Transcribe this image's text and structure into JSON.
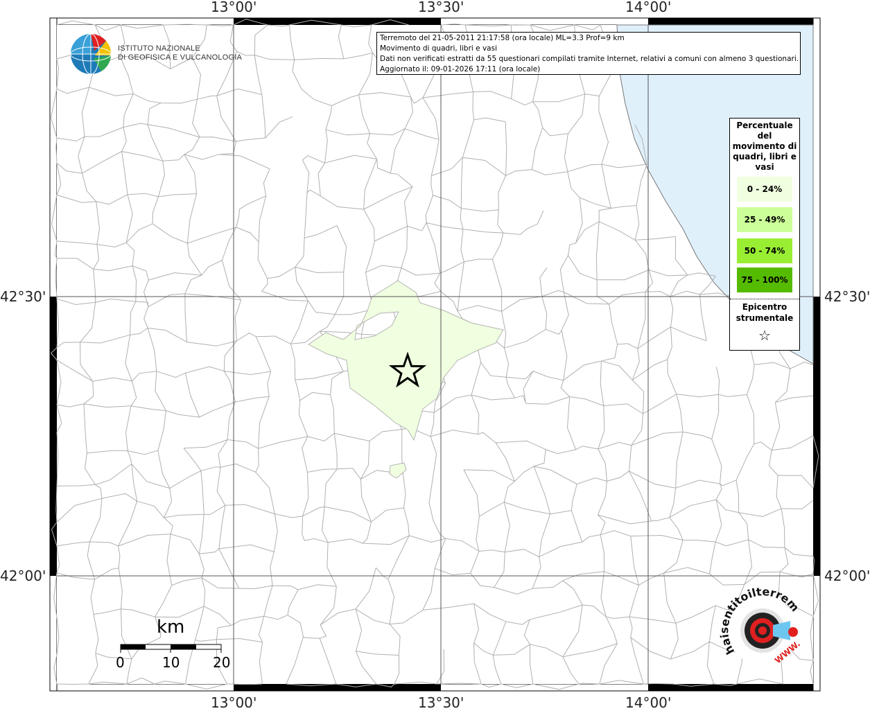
{
  "map": {
    "top_longitudes": [
      "13°00'",
      "13°30'",
      "14°00'"
    ],
    "bottom_longitudes": [
      "13°00'",
      "13°30'",
      "14°00'"
    ],
    "left_latitudes": [
      "42°30'",
      "42°00'"
    ],
    "right_latitudes": [
      "42°30'",
      "42°00'"
    ]
  },
  "info": {
    "line1": "Terremoto del 21-05-2011 21:17:58 (ora locale) ML=3.3 Prof=9 km",
    "line2": "Movimento di quadri, libri e vasi",
    "line3": "Dati non verificati estratti da 55 questionari compilati tramite Internet, relativi a comuni con almeno 3 questionari.",
    "line4": "Aggiornato il: 09-01-2026 17:11 (ora locale)"
  },
  "legend": {
    "title": "Percentuale del movimento di quadri, libri e vasi",
    "classes": [
      {
        "label": "0 - 24%",
        "color": "#f0ffe0"
      },
      {
        "label": "25 - 49%",
        "color": "#ccff99"
      },
      {
        "label": "50 - 74%",
        "color": "#99ee33"
      },
      {
        "label": "75 - 100%",
        "color": "#55bb00"
      }
    ],
    "epicenter_label": "Epicentro strumentale",
    "epicenter_symbol": "☆"
  },
  "logo": {
    "ingv_line1": "ISTITUTO NAZIONALE",
    "ingv_line2": "DI GEOFISICA E VULCANOLOGIA",
    "hsit_text": "haisentitoilterremoto.it",
    "hsit_www": "WWW."
  },
  "scale": {
    "unit": "km",
    "ticks": [
      "0",
      "10",
      "20"
    ]
  },
  "colors": {
    "sea": "#e0f0fb",
    "felt_area": "#f0ffe0",
    "boundaries": "#b0b0b0",
    "grid": "#555555"
  }
}
